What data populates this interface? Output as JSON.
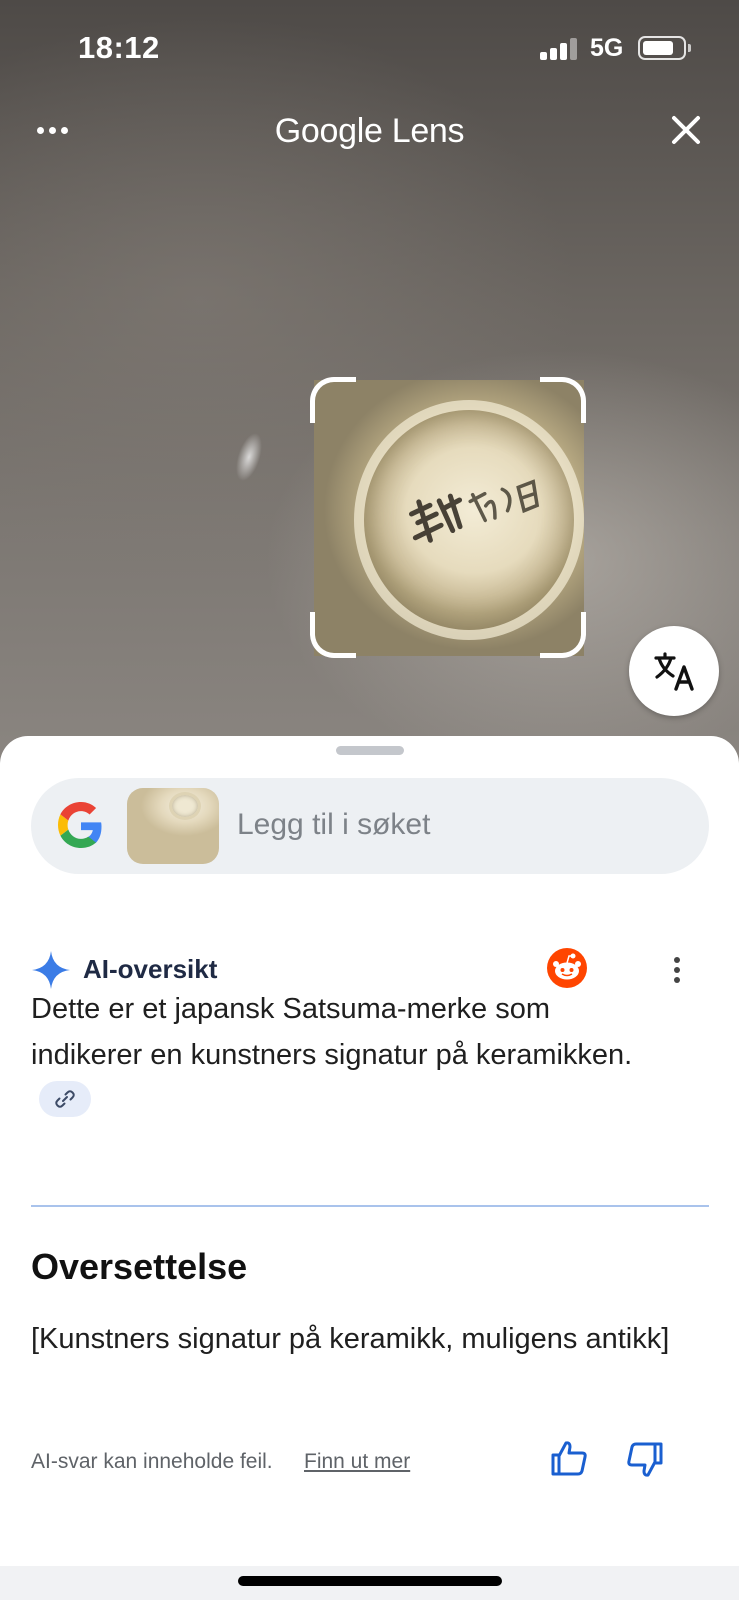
{
  "status_bar": {
    "time": "18:12",
    "network": "5G"
  },
  "top_bar": {
    "title": "Google Lens"
  },
  "search": {
    "placeholder": "Legg til i søket"
  },
  "ai_overview": {
    "title": "AI-oversikt",
    "body": "Dette er et japansk Satsuma-merke som indikerer en kunstners signatur på keramikken."
  },
  "translation": {
    "title": "Oversettelse",
    "text": "[Kunstners signatur på keramikk, muligens antikk]"
  },
  "footer": {
    "disclaimer": "AI-svar kan inneholde feil.",
    "learn_more": "Finn ut mer"
  },
  "colors": {
    "accent_blue": "#1a5fd0",
    "reddit": "#ff4500",
    "ai_title": "#1f2a44"
  },
  "icons": [
    "more-dots-icon",
    "close-icon",
    "translate-icon",
    "google-g-icon",
    "sparkle-icon",
    "reddit-icon",
    "kebab-icon",
    "link-icon",
    "thumbs-up-icon",
    "thumbs-down-icon"
  ]
}
